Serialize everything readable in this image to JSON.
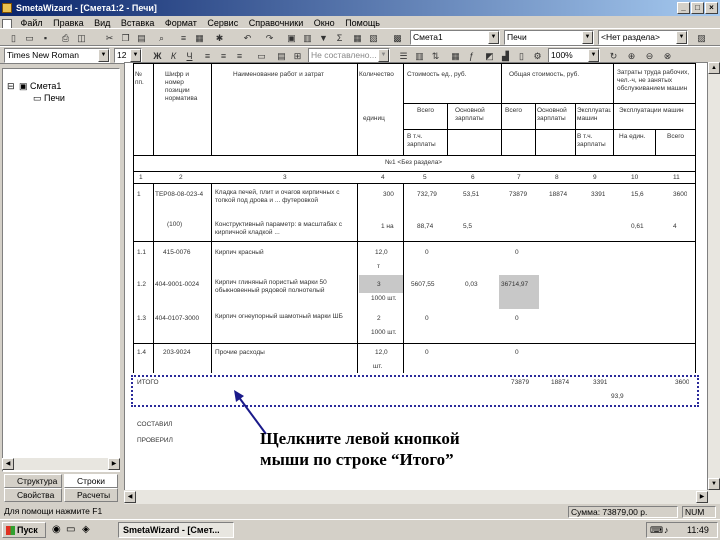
{
  "window": {
    "title": "SmetaWizard - [Смета1:2 - Печи]"
  },
  "menu": [
    "Файл",
    "Правка",
    "Вид",
    "Вставка",
    "Формат",
    "Сервис",
    "Справочники",
    "Окно",
    "Помощь"
  ],
  "toolbar1": {
    "estimate_combo": "Смета1",
    "section_combo": "Печи",
    "subsection_combo": "<Нет раздела>"
  },
  "toolbar2": {
    "font": "Times New Roman",
    "size": "12",
    "style_combo": "Не составлено...",
    "zoom": "100%"
  },
  "tree": {
    "root": "Смета1",
    "child": "Печи"
  },
  "side_tabs": [
    "Структура",
    "Строки",
    "Свойства",
    "Расчеты"
  ],
  "table": {
    "headers": {
      "num": "№ пп.",
      "code": "Шифр и номер позиции норматива",
      "name": "Наименование работ и затрат",
      "qty": "Количество",
      "unit": "единиц",
      "unit_cost": "Стоимость ед., руб.",
      "total_cost": "Общая стоимость, руб.",
      "labor": "Затраты труда рабочих, чел.-ч, не занятых обслуживанием машин",
      "all1": "Всего",
      "main_wage": "Основной зарплаты",
      "expl_mach": "Эксплуатации машин",
      "in_wage": "В т.ч. зарплаты",
      "all2": "Всего",
      "main_wage2": "Основной зарплаты",
      "expl_mach2": "Эксплуатации машин",
      "in_wage2": "В т.ч. зарплаты",
      "per_unit": "На един.",
      "total": "Всего"
    },
    "section_label": "№1 <Без раздела>",
    "col_numbers": [
      "1",
      "2",
      "3",
      "4",
      "5",
      "6",
      "7",
      "8",
      "9",
      "10",
      "11"
    ],
    "rows": [
      {
        "num": "1",
        "code": "ТЕР08-08-023-4",
        "name": "Кладка печей, плит и очагов кирпичных с топкой под дрова и ... футеровкой",
        "qty": "300",
        "c5": "732,79",
        "c6": "53,51",
        "c7": "73879",
        "c8": "18874",
        "c9": "3391",
        "c10": "15,6",
        "c11": "3600"
      },
      {
        "num": "",
        "code": "(100)",
        "name": "Конструктивный параметр: в масштабах с кирпичной кладкой ...",
        "qty": "1 на",
        "c5": "88,74",
        "c6": "5,5",
        "c7": "",
        "c8": "",
        "c9": "",
        "c10": "0,61",
        "c11": "4"
      },
      {
        "num": "1.1",
        "code": "415-0076",
        "name": "Кирпич красный",
        "qty": "12,0",
        "c5": "0",
        "c6": "",
        "c7": "0",
        "c8": "",
        "c9": "",
        "c10": "",
        "c11": ""
      },
      {
        "num": "1.2",
        "code": "404-9001-0024",
        "name": "Кирпич глиняный пористый марки 50 обыкновенный рядовой полнотелый",
        "qty": "3",
        "c5": "5607,55",
        "c6": "0,03",
        "c7": "36714,97",
        "c8": "",
        "c9": "",
        "c10": "",
        "c11": ""
      },
      {
        "num": "1.3",
        "code": "404-0107-3000",
        "name": "Кирпич огнеупорный шамотный марки ШБ",
        "qty": "2",
        "c5": "0",
        "c6": "",
        "c7": "0",
        "c8": "",
        "c9": "",
        "c10": "",
        "c11": ""
      },
      {
        "num": "1.4",
        "code": "203-9024",
        "name": "Прочие расходы",
        "qty": "12,0",
        "c5": "0",
        "c6": "",
        "c7": "0",
        "c8": "",
        "c9": "",
        "c10": "",
        "c11": ""
      }
    ],
    "row_units": {
      "a": "т",
      "b": "1000 шт.",
      "c": "1000 шт.",
      "d": "шт."
    },
    "total_row": {
      "label": "ИТОГО",
      "c7": "73879",
      "c8": "18874",
      "c9": "3391",
      "c11": "3600",
      "extra": "93,9"
    },
    "signatures": [
      "СОСТАВИЛ",
      "ПРОВЕРИЛ"
    ]
  },
  "callout": {
    "line1": "Щелкните левой кнопкой",
    "line2": "мыши по строке “Итого”"
  },
  "status": {
    "hint": "Для помощи нажмите F1",
    "amount": "Сумма: 73879,00 р.",
    "mode": "NUM"
  },
  "taskbar": {
    "start": "Пуск",
    "app": "SmetaWizard - [Смет...",
    "time": "11:49"
  }
}
